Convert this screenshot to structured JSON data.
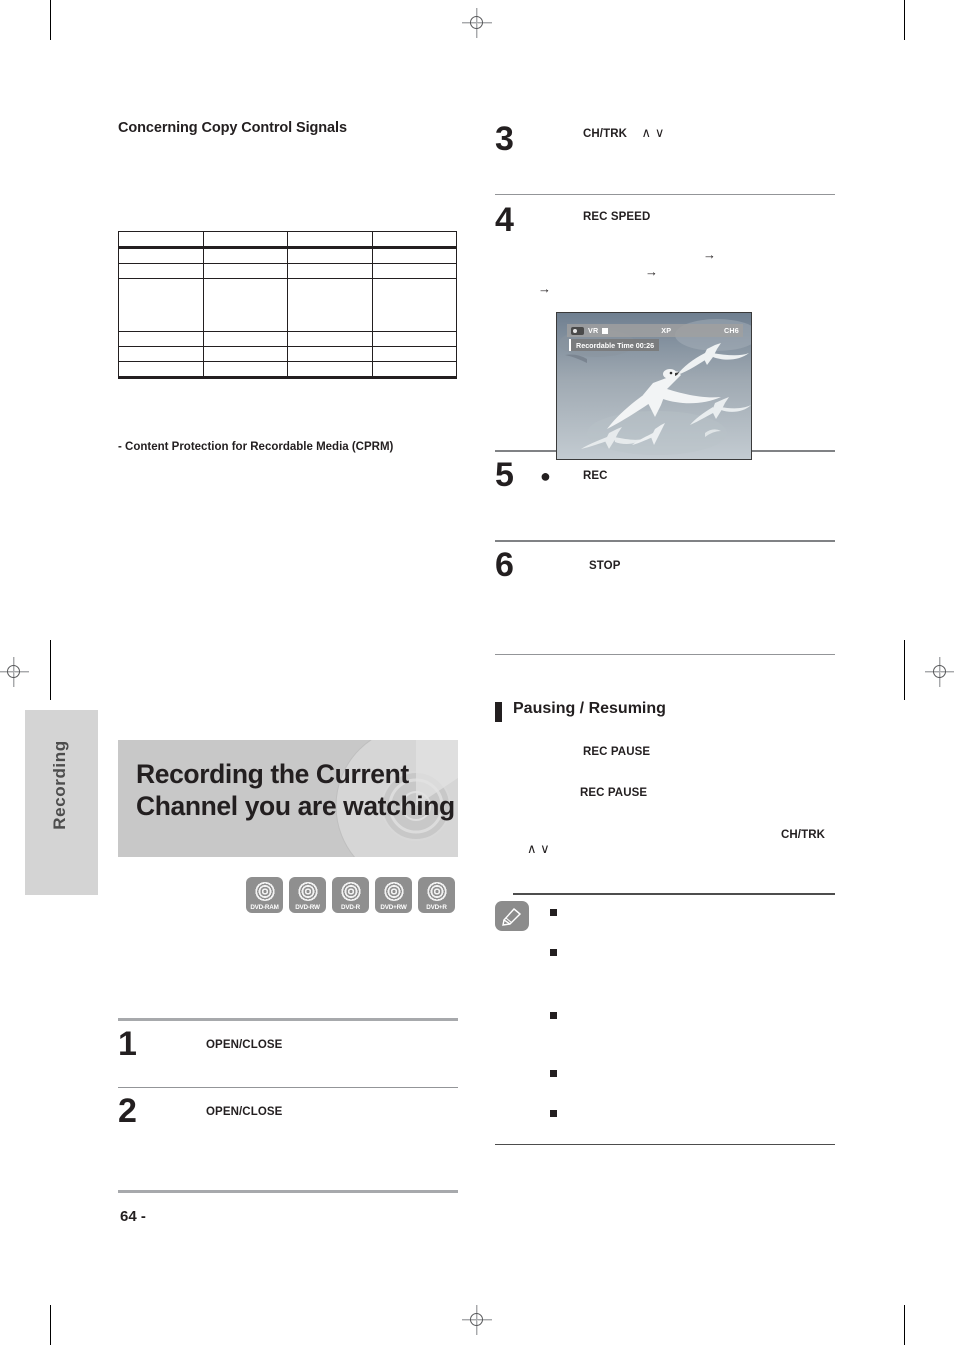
{
  "page": {
    "number_label": "64 -",
    "side_tab_label": "Recording"
  },
  "left_column": {
    "section_heading": "Concerning Copy Control Signals",
    "table": {
      "columns": [
        "",
        "",
        "",
        ""
      ],
      "rows": [
        [
          "",
          "",
          "",
          ""
        ],
        [
          "",
          "",
          "",
          ""
        ],
        [
          "",
          "",
          "",
          ""
        ],
        [
          "",
          "",
          "",
          ""
        ],
        [
          "",
          "",
          "",
          ""
        ],
        [
          "",
          "",
          "",
          ""
        ],
        [
          "",
          "",
          "",
          ""
        ]
      ]
    },
    "cprm_note": "- Content Protection for Recordable Media (CPRM)",
    "banner_title_line1": "Recording the Current",
    "banner_title_line2": "Channel you are watching",
    "disc_badges": [
      "DVD-RAM",
      "DVD-RW",
      "DVD-R",
      "DVD+RW",
      "DVD+R"
    ],
    "steps": [
      {
        "number": "1",
        "keyword": "OPEN/CLOSE"
      },
      {
        "number": "2",
        "keyword": "OPEN/CLOSE"
      }
    ]
  },
  "right_column": {
    "steps": [
      {
        "number": "3",
        "keyword": "CH/TRK",
        "glyphs": "∧ ∨"
      },
      {
        "number": "4",
        "keyword": "REC SPEED",
        "arrows": [
          "→",
          "→",
          "→"
        ]
      },
      {
        "number": "5",
        "bullet": "●",
        "keyword": "REC"
      },
      {
        "number": "6",
        "keyword": "STOP"
      }
    ],
    "tv_screen": {
      "disc_icon": "dvd-disc-icon",
      "mode": "VR",
      "status_icon": "stop-icon",
      "rec_speed": "XP",
      "channel": "CH6",
      "recordable_time": "Recordable Time 00:26"
    },
    "pausing_section": {
      "heading": "Pausing / Resuming",
      "keyword_1": "REC PAUSE",
      "keyword_2": "REC PAUSE",
      "keyword_3": "CH/TRK",
      "glyphs": "∧ ∨"
    },
    "note_box": {
      "icon": "pencil-icon",
      "bullets": [
        "",
        "",
        "",
        "",
        ""
      ]
    }
  },
  "colors": {
    "banner_bg": "#c8c8c8",
    "side_tab_bg": "#d4d4d4",
    "rule_gray": "#a7a9ac",
    "badge_gray": "#8f8f8f",
    "text": "#231f20"
  }
}
